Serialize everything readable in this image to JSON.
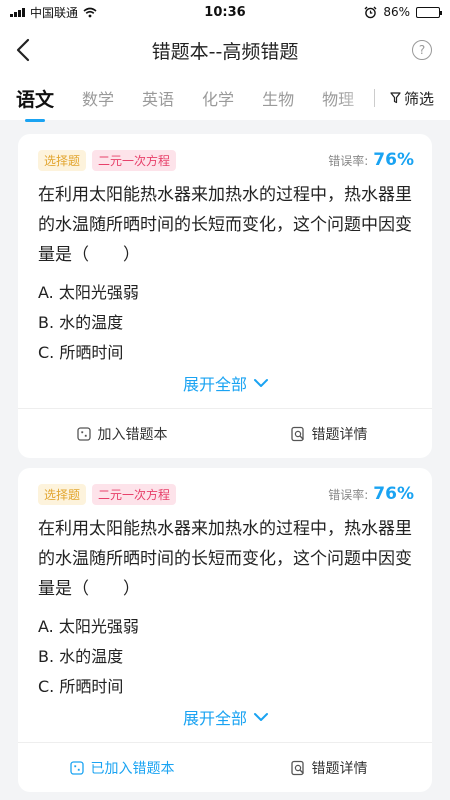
{
  "status_bar": {
    "carrier": "中国联通",
    "time": "10:36",
    "battery": "86%",
    "battery_level": 0.86
  },
  "header": {
    "title": "错题本--高频错题"
  },
  "tabs": [
    {
      "label": "语文",
      "active": true
    },
    {
      "label": "数学",
      "active": false
    },
    {
      "label": "英语",
      "active": false
    },
    {
      "label": "化学",
      "active": false
    },
    {
      "label": "生物",
      "active": false
    },
    {
      "label": "物理",
      "active": false
    }
  ],
  "filter": {
    "label": "筛选"
  },
  "cards": [
    {
      "type_tag": "选择题",
      "topic_tag": "二元一次方程",
      "error_rate_label": "错误率:",
      "error_rate": "76%",
      "question": "在利用太阳能热水器来加热水的过程中，热水器里的水温随所晒时间的长短而变化，这个问题中因变量是（　　）",
      "options": [
        "A. 太阳光强弱",
        "B. 水的温度",
        "C. 所晒时间"
      ],
      "expand_label": "展开全部",
      "add_label": "加入错题本",
      "detail_label": "错题详情"
    },
    {
      "type_tag": "选择题",
      "topic_tag": "二元一次方程",
      "error_rate_label": "错误率:",
      "error_rate": "76%",
      "question": "在利用太阳能热水器来加热水的过程中，热水器里的水温随所晒时间的长短而变化，这个问题中因变量是（　　）",
      "options": [
        "A. 太阳光强弱",
        "B. 水的温度",
        "C. 所晒时间"
      ],
      "expand_label": "展开全部",
      "add_label": "已加入错题本",
      "detail_label": "错题详情"
    }
  ],
  "colors": {
    "accent": "#1aa3f2",
    "tag_type": "#e2a630",
    "tag_topic": "#e7406a"
  }
}
